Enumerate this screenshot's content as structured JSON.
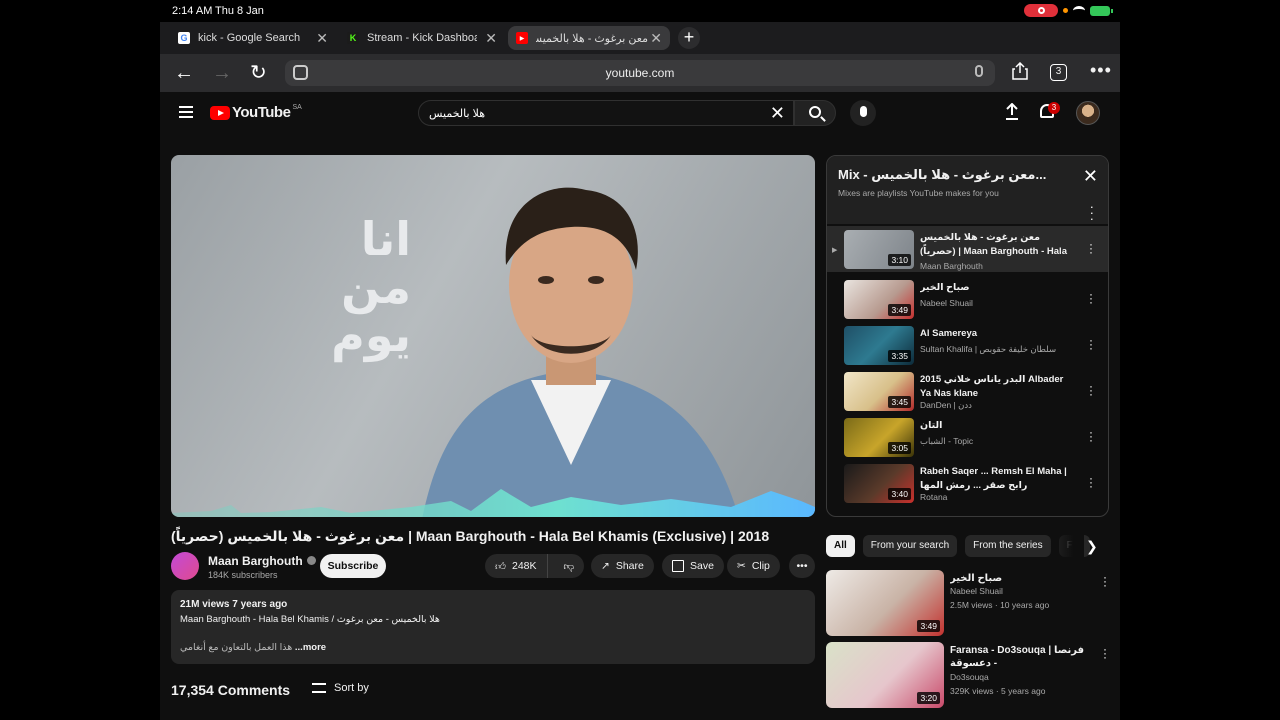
{
  "status": {
    "time": "2:14 AM",
    "date": "Thu 8 Jan"
  },
  "tabs": [
    {
      "label": "kick - Google Search",
      "fav": "G"
    },
    {
      "label": "Stream - Kick Dashboard",
      "fav": "K"
    },
    {
      "label": "معن برغوث - هلا بالخميس",
      "fav": "▶"
    }
  ],
  "address": {
    "url": "youtube.com",
    "tab_count": "3"
  },
  "yt": {
    "logo_text": "YouTube",
    "country": "SA",
    "search_value": "هلا بالخميس",
    "notif_count": "3"
  },
  "video": {
    "overlay_text_1": "انا من",
    "overlay_text_2": "يوم",
    "title": "معن برغوث - هلا بالخميس (حصرياً) | Maan Barghouth - Hala Bel Khamis (Exclusive) | 2018",
    "channel": "Maan Barghouth",
    "subscribers": "184K subscribers",
    "subscribe_label": "Subscribe",
    "likes": "248K",
    "share_label": "Share",
    "save_label": "Save",
    "clip_label": "Clip",
    "desc_stats": "21M views  7 years ago",
    "desc_line": "Maan Barghouth - Hala Bel Khamis /  هلا بالخميس - معن برغوث",
    "desc_snippet": "هذا العمل بالتعاون مع أنغامي",
    "desc_more": "...more",
    "comments": "17,354 Comments",
    "sort_label": "Sort by"
  },
  "playlist": {
    "title": "Mix - معن برغوث - هلا بالخميس...",
    "subtitle": "Mixes are playlists YouTube makes for you",
    "items": [
      {
        "title": "معن برغوث - هلا بالخميس (حصرياً) | Maan Barghouth - Hala Bel...",
        "channel": "Maan Barghouth",
        "duration": "3:10"
      },
      {
        "title": "صباح الخير",
        "channel": "Nabeel Shuail",
        "duration": "3:49"
      },
      {
        "title": "Al Samereya",
        "channel": "Sultan Khalifa | سلطان خليفة حقوبص",
        "duration": "3:35"
      },
      {
        "title": "البدر ياناس خلاني 2015 Albader Ya Nas klane",
        "channel": "DanDen | ددن",
        "duration": "3:45"
      },
      {
        "title": "التان",
        "channel": "الشباب - Topic",
        "duration": "3:05"
      },
      {
        "title": "Rabeh Saqer ... Remsh El Maha | رابح صقر ... رمش المها",
        "channel": "Rotana",
        "duration": "3:40"
      }
    ]
  },
  "chips": [
    "All",
    "From your search",
    "From the series",
    "Fro"
  ],
  "recommended": [
    {
      "title": "صباح الخير",
      "channel": "Nabeel Shuail",
      "meta": "2.5M views · 10 years ago",
      "duration": "3:49"
    },
    {
      "title": "Faransa - Do3souqa | فرنصا - دعسوقة",
      "channel": "Do3souqa",
      "meta": "329K views · 5 years ago",
      "duration": "3:20"
    }
  ]
}
